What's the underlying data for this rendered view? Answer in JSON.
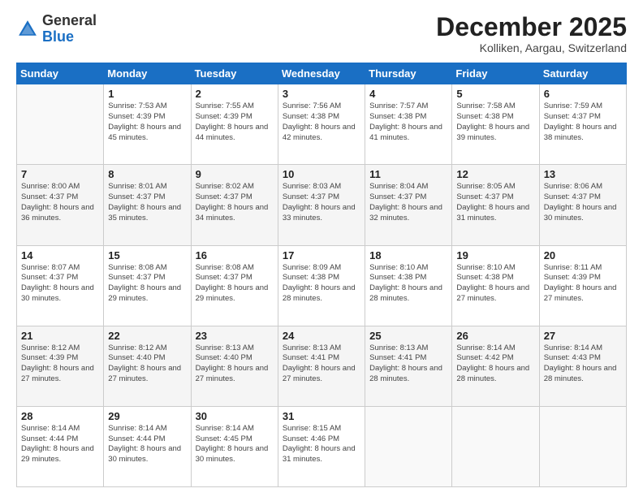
{
  "logo": {
    "general": "General",
    "blue": "Blue"
  },
  "header": {
    "month": "December 2025",
    "location": "Kolliken, Aargau, Switzerland"
  },
  "weekdays": [
    "Sunday",
    "Monday",
    "Tuesday",
    "Wednesday",
    "Thursday",
    "Friday",
    "Saturday"
  ],
  "weeks": [
    [
      {
        "day": "",
        "sunrise": "",
        "sunset": "",
        "daylight": ""
      },
      {
        "day": "1",
        "sunrise": "Sunrise: 7:53 AM",
        "sunset": "Sunset: 4:39 PM",
        "daylight": "Daylight: 8 hours and 45 minutes."
      },
      {
        "day": "2",
        "sunrise": "Sunrise: 7:55 AM",
        "sunset": "Sunset: 4:39 PM",
        "daylight": "Daylight: 8 hours and 44 minutes."
      },
      {
        "day": "3",
        "sunrise": "Sunrise: 7:56 AM",
        "sunset": "Sunset: 4:38 PM",
        "daylight": "Daylight: 8 hours and 42 minutes."
      },
      {
        "day": "4",
        "sunrise": "Sunrise: 7:57 AM",
        "sunset": "Sunset: 4:38 PM",
        "daylight": "Daylight: 8 hours and 41 minutes."
      },
      {
        "day": "5",
        "sunrise": "Sunrise: 7:58 AM",
        "sunset": "Sunset: 4:38 PM",
        "daylight": "Daylight: 8 hours and 39 minutes."
      },
      {
        "day": "6",
        "sunrise": "Sunrise: 7:59 AM",
        "sunset": "Sunset: 4:37 PM",
        "daylight": "Daylight: 8 hours and 38 minutes."
      }
    ],
    [
      {
        "day": "7",
        "sunrise": "Sunrise: 8:00 AM",
        "sunset": "Sunset: 4:37 PM",
        "daylight": "Daylight: 8 hours and 36 minutes."
      },
      {
        "day": "8",
        "sunrise": "Sunrise: 8:01 AM",
        "sunset": "Sunset: 4:37 PM",
        "daylight": "Daylight: 8 hours and 35 minutes."
      },
      {
        "day": "9",
        "sunrise": "Sunrise: 8:02 AM",
        "sunset": "Sunset: 4:37 PM",
        "daylight": "Daylight: 8 hours and 34 minutes."
      },
      {
        "day": "10",
        "sunrise": "Sunrise: 8:03 AM",
        "sunset": "Sunset: 4:37 PM",
        "daylight": "Daylight: 8 hours and 33 minutes."
      },
      {
        "day": "11",
        "sunrise": "Sunrise: 8:04 AM",
        "sunset": "Sunset: 4:37 PM",
        "daylight": "Daylight: 8 hours and 32 minutes."
      },
      {
        "day": "12",
        "sunrise": "Sunrise: 8:05 AM",
        "sunset": "Sunset: 4:37 PM",
        "daylight": "Daylight: 8 hours and 31 minutes."
      },
      {
        "day": "13",
        "sunrise": "Sunrise: 8:06 AM",
        "sunset": "Sunset: 4:37 PM",
        "daylight": "Daylight: 8 hours and 30 minutes."
      }
    ],
    [
      {
        "day": "14",
        "sunrise": "Sunrise: 8:07 AM",
        "sunset": "Sunset: 4:37 PM",
        "daylight": "Daylight: 8 hours and 30 minutes."
      },
      {
        "day": "15",
        "sunrise": "Sunrise: 8:08 AM",
        "sunset": "Sunset: 4:37 PM",
        "daylight": "Daylight: 8 hours and 29 minutes."
      },
      {
        "day": "16",
        "sunrise": "Sunrise: 8:08 AM",
        "sunset": "Sunset: 4:37 PM",
        "daylight": "Daylight: 8 hours and 29 minutes."
      },
      {
        "day": "17",
        "sunrise": "Sunrise: 8:09 AM",
        "sunset": "Sunset: 4:38 PM",
        "daylight": "Daylight: 8 hours and 28 minutes."
      },
      {
        "day": "18",
        "sunrise": "Sunrise: 8:10 AM",
        "sunset": "Sunset: 4:38 PM",
        "daylight": "Daylight: 8 hours and 28 minutes."
      },
      {
        "day": "19",
        "sunrise": "Sunrise: 8:10 AM",
        "sunset": "Sunset: 4:38 PM",
        "daylight": "Daylight: 8 hours and 27 minutes."
      },
      {
        "day": "20",
        "sunrise": "Sunrise: 8:11 AM",
        "sunset": "Sunset: 4:39 PM",
        "daylight": "Daylight: 8 hours and 27 minutes."
      }
    ],
    [
      {
        "day": "21",
        "sunrise": "Sunrise: 8:12 AM",
        "sunset": "Sunset: 4:39 PM",
        "daylight": "Daylight: 8 hours and 27 minutes."
      },
      {
        "day": "22",
        "sunrise": "Sunrise: 8:12 AM",
        "sunset": "Sunset: 4:40 PM",
        "daylight": "Daylight: 8 hours and 27 minutes."
      },
      {
        "day": "23",
        "sunrise": "Sunrise: 8:13 AM",
        "sunset": "Sunset: 4:40 PM",
        "daylight": "Daylight: 8 hours and 27 minutes."
      },
      {
        "day": "24",
        "sunrise": "Sunrise: 8:13 AM",
        "sunset": "Sunset: 4:41 PM",
        "daylight": "Daylight: 8 hours and 27 minutes."
      },
      {
        "day": "25",
        "sunrise": "Sunrise: 8:13 AM",
        "sunset": "Sunset: 4:41 PM",
        "daylight": "Daylight: 8 hours and 28 minutes."
      },
      {
        "day": "26",
        "sunrise": "Sunrise: 8:14 AM",
        "sunset": "Sunset: 4:42 PM",
        "daylight": "Daylight: 8 hours and 28 minutes."
      },
      {
        "day": "27",
        "sunrise": "Sunrise: 8:14 AM",
        "sunset": "Sunset: 4:43 PM",
        "daylight": "Daylight: 8 hours and 28 minutes."
      }
    ],
    [
      {
        "day": "28",
        "sunrise": "Sunrise: 8:14 AM",
        "sunset": "Sunset: 4:44 PM",
        "daylight": "Daylight: 8 hours and 29 minutes."
      },
      {
        "day": "29",
        "sunrise": "Sunrise: 8:14 AM",
        "sunset": "Sunset: 4:44 PM",
        "daylight": "Daylight: 8 hours and 30 minutes."
      },
      {
        "day": "30",
        "sunrise": "Sunrise: 8:14 AM",
        "sunset": "Sunset: 4:45 PM",
        "daylight": "Daylight: 8 hours and 30 minutes."
      },
      {
        "day": "31",
        "sunrise": "Sunrise: 8:15 AM",
        "sunset": "Sunset: 4:46 PM",
        "daylight": "Daylight: 8 hours and 31 minutes."
      },
      {
        "day": "",
        "sunrise": "",
        "sunset": "",
        "daylight": ""
      },
      {
        "day": "",
        "sunrise": "",
        "sunset": "",
        "daylight": ""
      },
      {
        "day": "",
        "sunrise": "",
        "sunset": "",
        "daylight": ""
      }
    ]
  ]
}
